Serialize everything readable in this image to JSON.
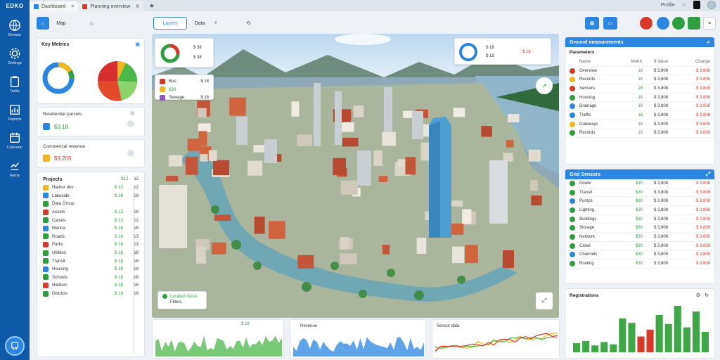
{
  "rail": {
    "logo": "EDKO",
    "items": [
      {
        "label": "Browse",
        "icon": "globe-icon"
      },
      {
        "label": "Settings",
        "icon": "gear-icon"
      },
      {
        "label": "Tasks",
        "icon": "clipboard-icon"
      },
      {
        "label": "Reports",
        "icon": "chart-icon"
      },
      {
        "label": "Calendar",
        "icon": "calendar-icon"
      },
      {
        "label": "Alerts",
        "icon": "signal-icon"
      }
    ],
    "bottom_icon": "transit-icon"
  },
  "browser": {
    "tabs": [
      {
        "label": "Dashboard",
        "color": "#2a86e0"
      },
      {
        "label": "Planning overview",
        "color": "#d83a2a"
      }
    ],
    "close": "X",
    "right_label": "Profile"
  },
  "toolbar": {
    "left_buttons": [
      {
        "label": "",
        "icon": "home-icon"
      },
      {
        "label": "Map",
        "icon": "map-icon"
      },
      {
        "label": "",
        "icon": "bell-icon"
      }
    ],
    "mid_buttons": [
      {
        "label": "Layers",
        "icon": "layers-icon"
      },
      {
        "label": "Data",
        "icon": "data-icon"
      },
      {
        "label": "",
        "icon": "search-icon"
      },
      {
        "label": "",
        "icon": "link-icon"
      }
    ]
  },
  "left": {
    "summary_title": "Key Metrics",
    "stat1": {
      "label": "Residential parcels",
      "value": "$3.18",
      "count": "18"
    },
    "stat2": {
      "label": "Commercial revenue",
      "value": "$3,205"
    },
    "list_title": "Projects",
    "list_head": {
      "a": "$12",
      "b": "12"
    },
    "sub_label": "Data Group",
    "items": [
      {
        "name": "Harbor dev",
        "v1": "$ 12",
        "v2": "12"
      },
      {
        "name": "Lakeside",
        "v1": "$ 18",
        "v2": "18"
      },
      {
        "name": "Data Group",
        "v1": "",
        "v2": ""
      },
      {
        "name": "Assets",
        "v1": "$ 12",
        "v2": "18"
      },
      {
        "name": "Canals",
        "v1": "$ 13",
        "v2": "12"
      },
      {
        "name": "Marina",
        "v1": "$ 18",
        "v2": "18"
      },
      {
        "name": "Roads",
        "v1": "$ 18",
        "v2": "13"
      },
      {
        "name": "Parks",
        "v1": "$ 16",
        "v2": "13"
      },
      {
        "name": "Utilities",
        "v1": "$ 18",
        "v2": "18"
      },
      {
        "name": "Transit",
        "v1": "$ 18",
        "v2": "18"
      },
      {
        "name": "Housing",
        "v1": "$ 18",
        "v2": "18"
      },
      {
        "name": "Schools",
        "v1": "$ 18",
        "v2": "18"
      },
      {
        "name": "Harbors",
        "v1": "$ 18",
        "v2": "18"
      },
      {
        "name": "Districts",
        "v1": "$ 18",
        "v2": "18"
      }
    ]
  },
  "map_overlays": {
    "top_left": {
      "a": "$ 38",
      "b": "$ 38"
    },
    "layers": [
      {
        "name": "Bus",
        "value": "$ 18"
      },
      {
        "name": "$30",
        "value": ""
      },
      {
        "name": "Sewage",
        "value": "$ 18"
      }
    ],
    "top_right": {
      "a": "$ 18",
      "b": "$ 18",
      "c": "$ 18"
    },
    "legend": {
      "title": "Location focus",
      "sub": "Filters"
    }
  },
  "bottom_charts": [
    {
      "title": "",
      "value": "$ 18"
    },
    {
      "title": "Revenue",
      "value": ""
    },
    {
      "title": "Sensor data",
      "value": ""
    }
  ],
  "right": {
    "search_title": "Ground measurements",
    "table_title": "Parameters",
    "table_cols": [
      "Name",
      "Metric",
      "$ Value",
      "Change"
    ],
    "table_rows": [
      {
        "name": "Overview",
        "metric": "18",
        "value": "$ 3,808",
        "change": "$ 3,808"
      },
      {
        "name": "Records",
        "metric": "18",
        "value": "$ 3,808",
        "change": "$ 3,808"
      },
      {
        "name": "Sensors",
        "metric": "18",
        "value": "$ 3,808",
        "change": "$ 3,808"
      },
      {
        "name": "Housing",
        "metric": "18",
        "value": "$ 3,808",
        "change": "$ 3,808"
      },
      {
        "name": "Drainage",
        "metric": "18",
        "value": "$ 3,808",
        "change": "$ 3,808"
      },
      {
        "name": "Traffic",
        "metric": "18",
        "value": "$ 3,808",
        "change": "$ 3,808"
      },
      {
        "name": "Gateways",
        "metric": "18",
        "value": "$ 3,808",
        "change": "$ 3,808"
      },
      {
        "name": "Records",
        "metric": "18",
        "value": "$ 3,808",
        "change": "$ 3,808"
      }
    ],
    "table2_title": "Grid Sensors",
    "table2_rows": [
      {
        "name": "Power",
        "metric": "$30",
        "value": "$ 3,808",
        "change": "$ 3,808"
      },
      {
        "name": "Transit",
        "metric": "$30",
        "value": "$ 3,808",
        "change": "$ 3,808"
      },
      {
        "name": "Pumps",
        "metric": "$30",
        "value": "$ 3,808",
        "change": "$ 3,808"
      },
      {
        "name": "Lighting",
        "metric": "$30",
        "value": "$ 3,808",
        "change": "$ 3,808"
      },
      {
        "name": "Buildings",
        "metric": "$30",
        "value": "$ 3,808",
        "change": "$ 3,808"
      },
      {
        "name": "Storage",
        "metric": "$30",
        "value": "$ 3,808",
        "change": "$ 3,808"
      },
      {
        "name": "Network",
        "metric": "$30",
        "value": "$ 3,808",
        "change": "$ 3,808"
      },
      {
        "name": "Canal",
        "metric": "$30",
        "value": "$ 3,808",
        "change": "$ 3,808"
      },
      {
        "name": "Channels",
        "metric": "$30",
        "value": "$ 3,808",
        "change": "$ 3,808"
      },
      {
        "name": "Routing",
        "metric": "$30",
        "value": "$ 3,808",
        "change": "$ 3,808"
      }
    ],
    "bar_title": "Registrations",
    "bar_values": [
      8,
      10,
      6,
      9,
      7,
      30,
      26,
      14,
      20,
      33,
      25,
      41,
      22,
      36,
      18
    ]
  },
  "colors": {
    "rail": "#0f5aa8",
    "accent": "#2a86e0",
    "green": "#2e9e3e",
    "red": "#d83a2a"
  }
}
